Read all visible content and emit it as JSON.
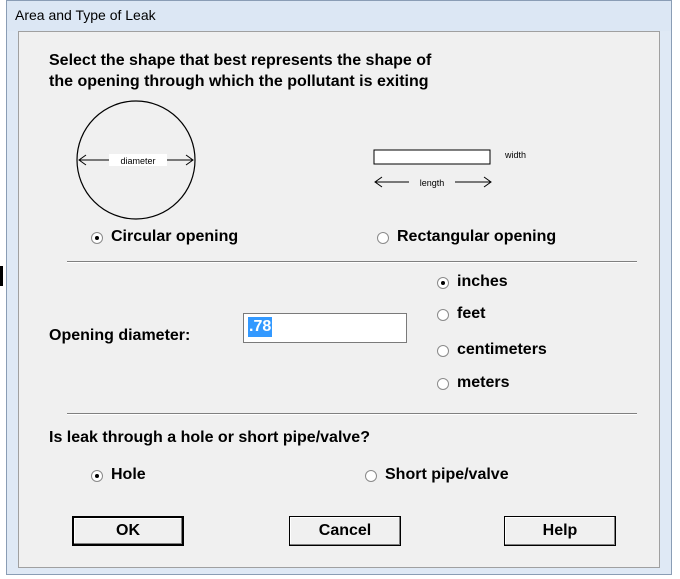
{
  "window": {
    "title": "Area and Type of Leak"
  },
  "instruction": {
    "line1": "Select the shape that best represents the shape of",
    "line2": "the opening through which the pollutant is exiting"
  },
  "shapes": {
    "circle_label": "diameter",
    "rect_width_label": "width",
    "rect_length_label": "length"
  },
  "opening_type": {
    "options": [
      {
        "label": "Circular opening",
        "selected": true
      },
      {
        "label": "Rectangular opening",
        "selected": false
      }
    ]
  },
  "diameter": {
    "label": "Opening diameter:",
    "value": ".78"
  },
  "units": {
    "options": [
      {
        "label": "inches",
        "selected": true
      },
      {
        "label": "feet",
        "selected": false
      },
      {
        "label": "centimeters",
        "selected": false
      },
      {
        "label": "meters",
        "selected": false
      }
    ]
  },
  "leak": {
    "question": "Is leak through a hole or short pipe/valve?",
    "options": [
      {
        "label": "Hole",
        "selected": true
      },
      {
        "label": "Short pipe/valve",
        "selected": false
      }
    ]
  },
  "buttons": {
    "ok": "OK",
    "cancel": "Cancel",
    "help": "Help"
  },
  "colors": {
    "dialog_bg": "#f0f0f0",
    "selection": "#3399ff",
    "frame": "#dce7f4"
  }
}
